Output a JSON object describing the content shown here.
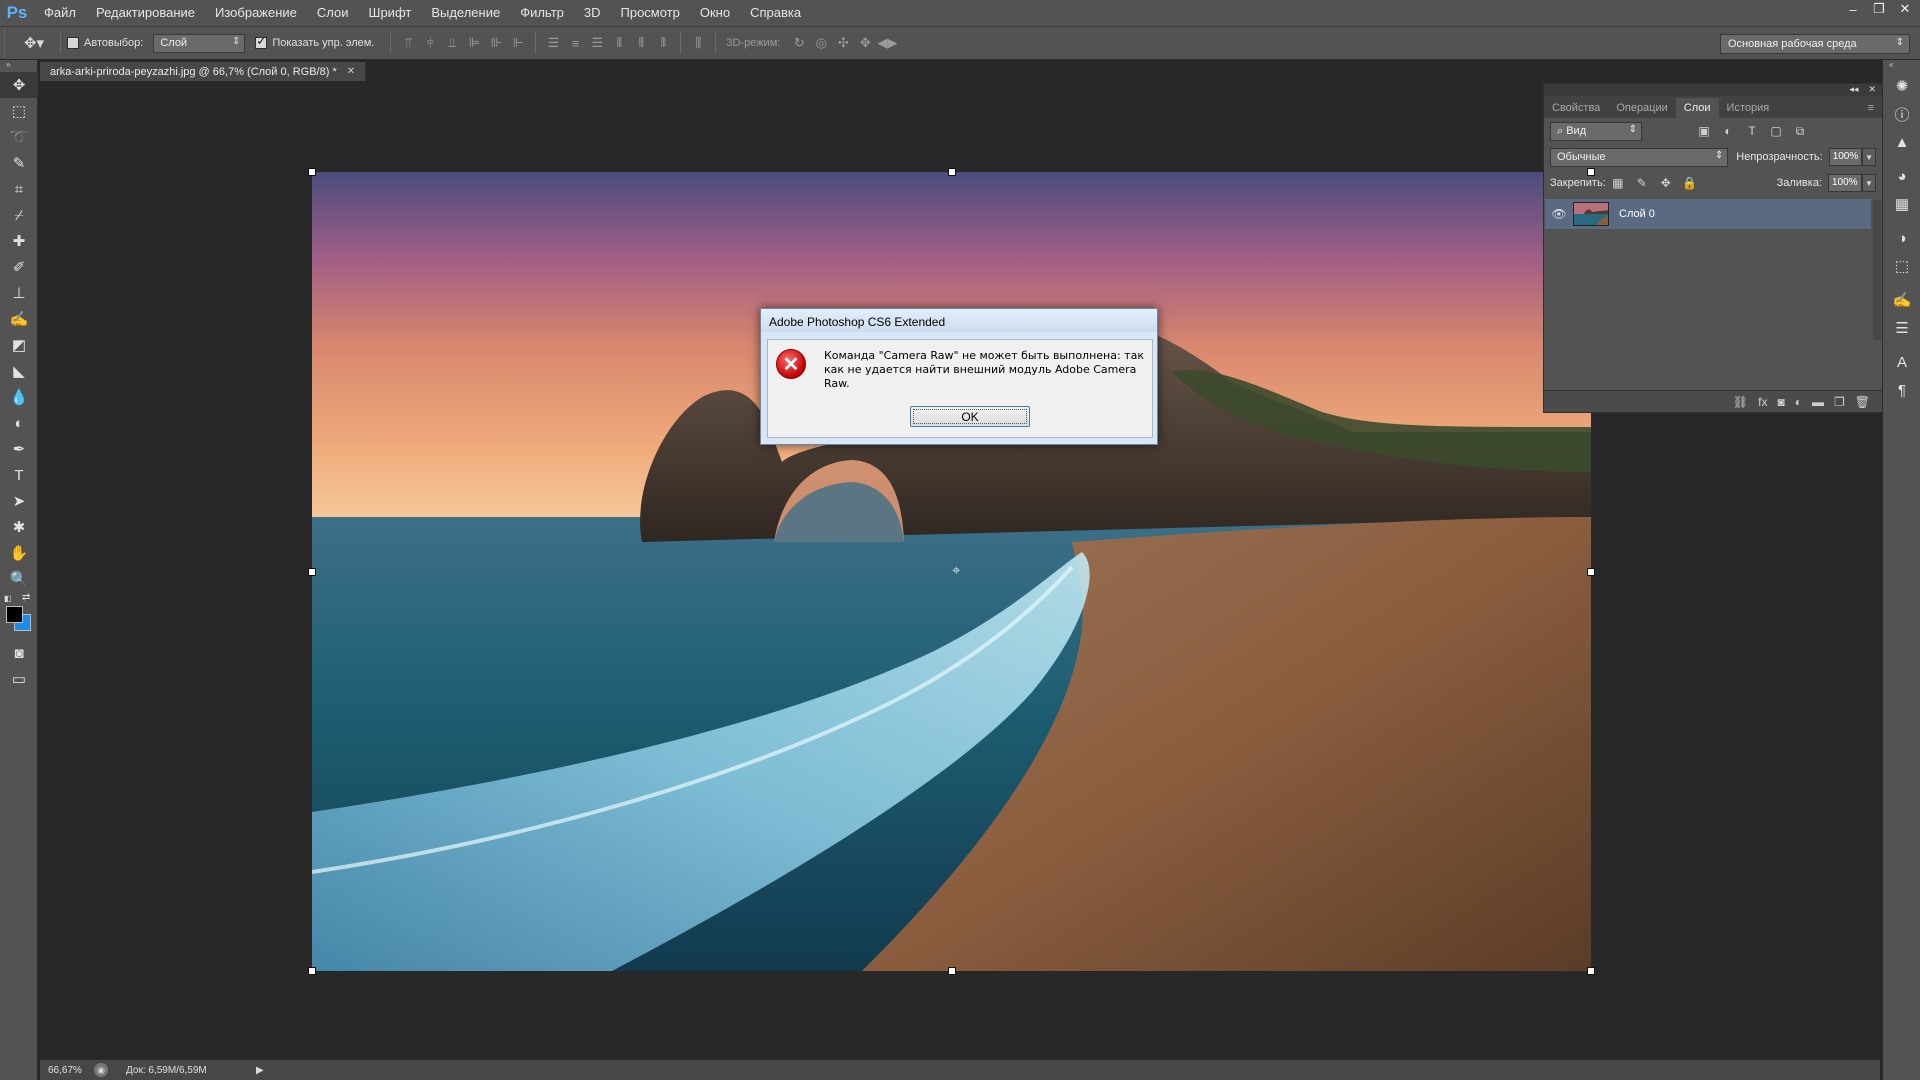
{
  "app": {
    "logo": "Ps"
  },
  "menu": [
    "Файл",
    "Редактирование",
    "Изображение",
    "Слои",
    "Шрифт",
    "Выделение",
    "Фильтр",
    "3D",
    "Просмотр",
    "Окно",
    "Справка"
  ],
  "window_controls": [
    "–",
    "❐",
    "✕"
  ],
  "options_bar": {
    "autoselect_label": "Автовыбор:",
    "autoselect_value": "Слой",
    "show_transform_label": "Показать упр. элем.",
    "mode_3d_label": "3D-режим:",
    "workspace": "Основная рабочая среда"
  },
  "document": {
    "tab_title": "arka-arki-priroda-peyzazhi.jpg @ 66,7% (Слой 0, RGB/8) *",
    "zoom": "66,67%",
    "doc_size": "Док: 6,59M/6,59M"
  },
  "tools": [
    "move-tool",
    "marquee-tool",
    "lasso-tool",
    "quick-select-tool",
    "crop-tool",
    "eyedropper-tool",
    "healing-tool",
    "brush-tool",
    "stamp-tool",
    "history-brush-tool",
    "eraser-tool",
    "bucket-tool",
    "blur-tool",
    "dodge-tool",
    "pen-tool",
    "type-tool",
    "path-select-tool",
    "shape-tool",
    "hand-tool",
    "zoom-tool"
  ],
  "colors": {
    "foreground": "#000000",
    "background": "#1d8be8",
    "accent": "#5fb2ff"
  },
  "layers_panel": {
    "tabs": [
      "Свойства",
      "Операции",
      "Слои",
      "История"
    ],
    "active_tab": "Слои",
    "filter": "Вид",
    "blend_mode": "Обычные",
    "opacity_label": "Непрозрачность:",
    "opacity_value": "100%",
    "lock_label": "Закрепить:",
    "fill_label": "Заливка:",
    "fill_value": "100%",
    "layers": [
      {
        "name": "Слой 0",
        "visible": true
      }
    ]
  },
  "dialog": {
    "title": "Adobe Photoshop CS6 Extended",
    "message": "Команда \"Camera Raw\" не может быть выполнена: так как не удается найти внешний модуль Adobe Camera Raw.",
    "ok_label": "OK",
    "icon": "error-icon"
  }
}
